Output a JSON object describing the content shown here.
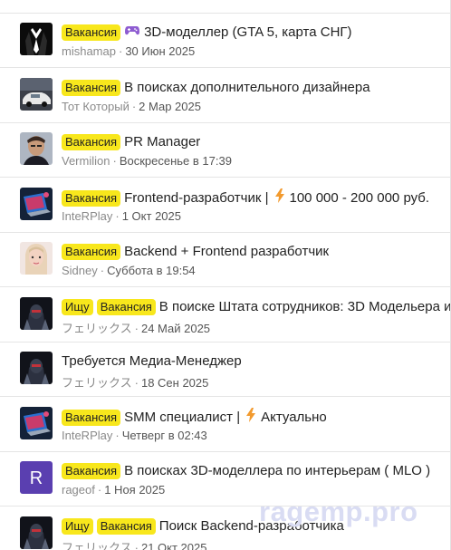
{
  "threads": [
    {
      "prefixes": [
        "Вакансия"
      ],
      "icon": "gamepad-icon",
      "title": "3D-моделлер (GTA 5, карта СНГ)",
      "author": "mishamap",
      "date": "30 Июн 2025",
      "avatar": "suit"
    },
    {
      "prefixes": [
        "Вакансия"
      ],
      "title": "В поисках дополнительного дизайнера",
      "author": "Тот Который",
      "date": "2 Мар 2025",
      "avatar": "car"
    },
    {
      "prefixes": [
        "Вакансия"
      ],
      "title": "PR Manager",
      "author": "Vermilion",
      "date": "Воскресенье в 17:39",
      "avatar": "man"
    },
    {
      "prefixes": [
        "Вакансия"
      ],
      "title_pre": "Frontend-разработчик |",
      "icon": "lightning-icon",
      "title": "100 000 - 200 000 руб.",
      "author": "InteRPlay",
      "date": "1 Окт 2025",
      "avatar": "laptop"
    },
    {
      "prefixes": [
        "Вакансия"
      ],
      "title": "Backend + Frontend разработчик",
      "author": "Sidney",
      "date": "Суббота в 19:54",
      "avatar": "girl"
    },
    {
      "prefixes": [
        "Ищу",
        "Вакансия"
      ],
      "title": "В поиске Штата сотрудников: 3D Модельера и",
      "author": "フェリックス",
      "date": "24 Май 2025",
      "avatar": "robot"
    },
    {
      "prefixes": [],
      "title": "Требуется Медиа-Менеджер",
      "author": "フェリックス",
      "date": "18 Сен 2025",
      "avatar": "robot"
    },
    {
      "prefixes": [
        "Вакансия"
      ],
      "title_pre": "SMM специалист |",
      "icon": "lightning-icon",
      "title": "Актуально",
      "author": "InteRPlay",
      "date": "Четверг в 02:43",
      "avatar": "laptop"
    },
    {
      "prefixes": [
        "Вакансия"
      ],
      "title": "В поисках 3D-моделлера по интерьерам ( MLO )",
      "author": "rageof",
      "date": "1 Ноя 2025",
      "avatar": "letter",
      "avatar_letter": "R"
    },
    {
      "prefixes": [
        "Ищу",
        "Вакансия"
      ],
      "title": "Поиск Backend-разработчика",
      "author": "フェリックス",
      "date": "21 Окт 2025",
      "avatar": "robot"
    }
  ],
  "colors": {
    "badge": "#f8e71c",
    "letter_avatar": "#5a3fb0"
  },
  "watermark": "ragemp.pro"
}
